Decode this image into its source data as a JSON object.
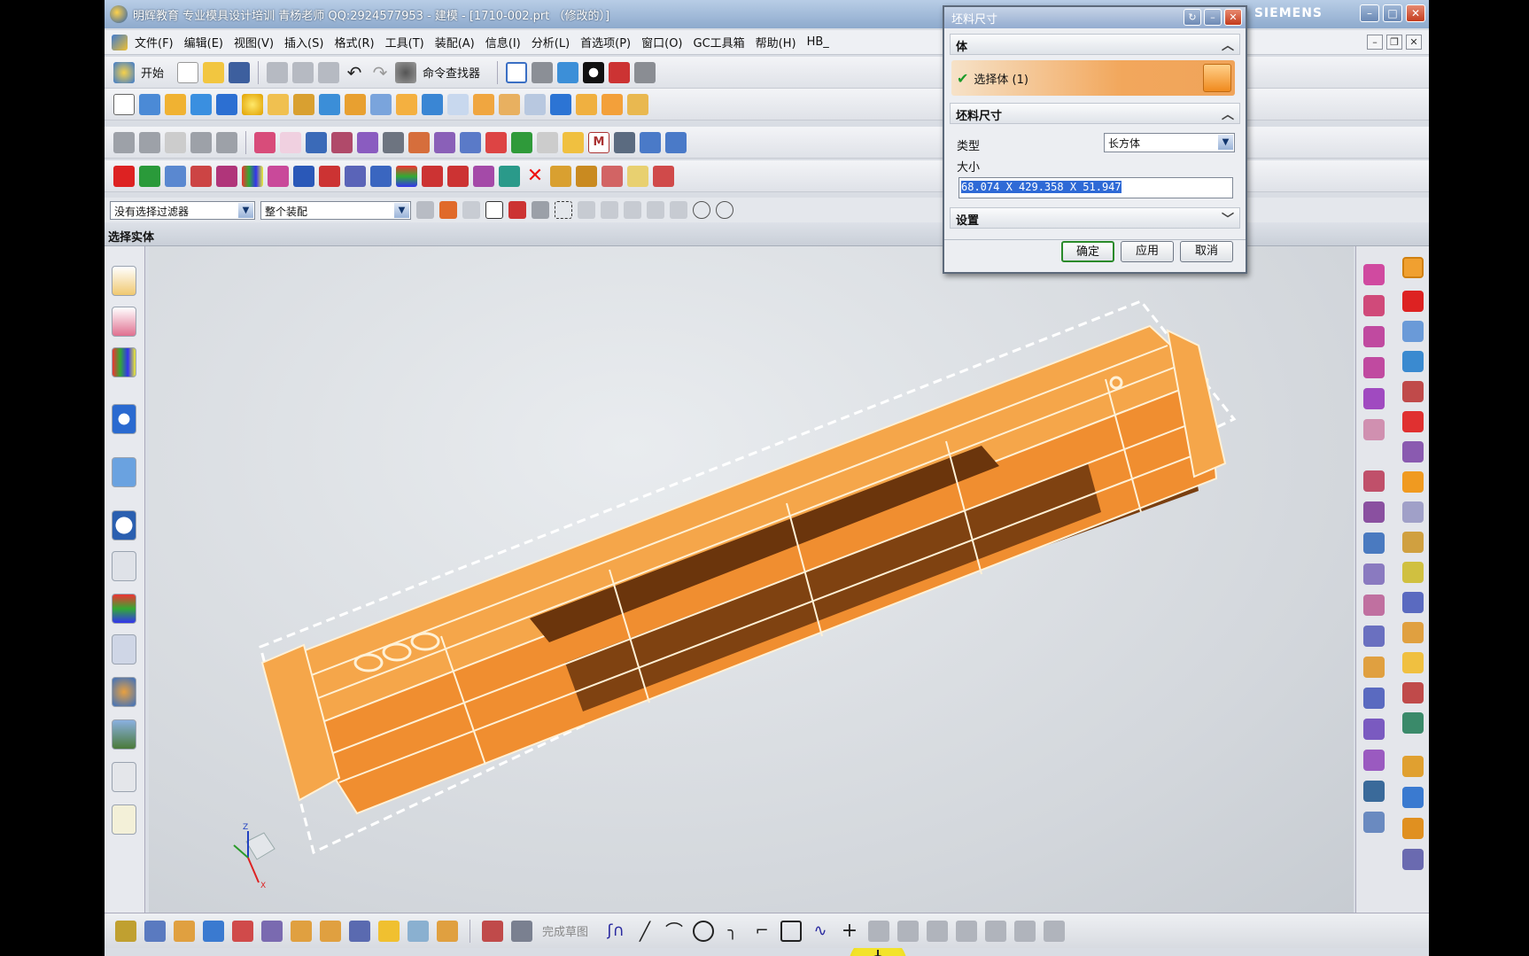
{
  "window": {
    "title": "明辉教育 专业模具设计培训 青杨老师  QQ:2924577953 - 建模 - [1710-002.prt （修改的）]",
    "brand": "SIEMENS",
    "controls": {
      "minimize": "–",
      "maximize": "□",
      "close": "✕"
    }
  },
  "menu": {
    "items": [
      "文件(F)",
      "编辑(E)",
      "视图(V)",
      "插入(S)",
      "格式(R)",
      "工具(T)",
      "装配(A)",
      "信息(I)",
      "分析(L)",
      "首选项(P)",
      "窗口(O)",
      "GC工具箱",
      "帮助(H)",
      "HB_"
    ]
  },
  "toolbar": {
    "start_label": "开始",
    "command_finder_label": "命令查找器"
  },
  "filterbar": {
    "selection_filter": "没有选择过滤器",
    "scope": "整个装配"
  },
  "cue_line": "选择实体",
  "dialog": {
    "title": "坯料尺寸",
    "body_group": "体",
    "select_body": "选择体 (1)",
    "stock_group": "坯料尺寸",
    "type_label": "类型",
    "type_value": "长方体",
    "size_label": "大小",
    "size_value": "68.074 X 429.358 X 51.947",
    "settings_group": "设置",
    "ok": "确定",
    "apply": "应用",
    "cancel": "取消"
  },
  "bottom_toolbar": {
    "finish_sketch_label": "完成草图"
  },
  "colors": {
    "part_fill": "#f5a64a",
    "part_edge": "#fff1d6",
    "part_shadow": "#7a3f10",
    "cursor": "#f2e32c",
    "selected_text_bg": "#2f6ad6"
  }
}
